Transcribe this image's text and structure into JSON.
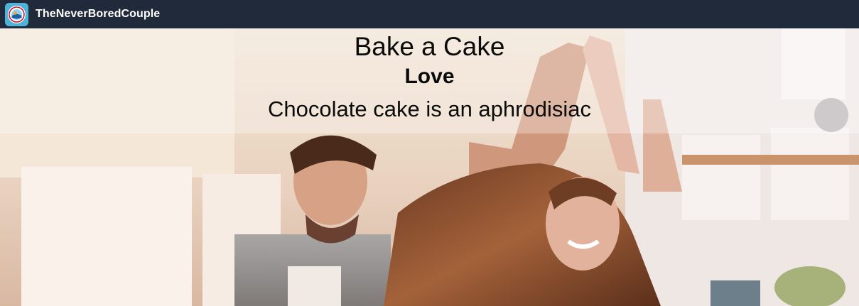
{
  "navbar": {
    "brand": "TheNeverBoredCouple",
    "logo_icon": "couple-logo-icon",
    "bg_color": "#212a3a"
  },
  "hero": {
    "title": "Bake a Cake",
    "category": "Love",
    "text": "Chocolate cake is an aphrodisiac",
    "image": "couple-dancing-in-kitchen-photo"
  }
}
